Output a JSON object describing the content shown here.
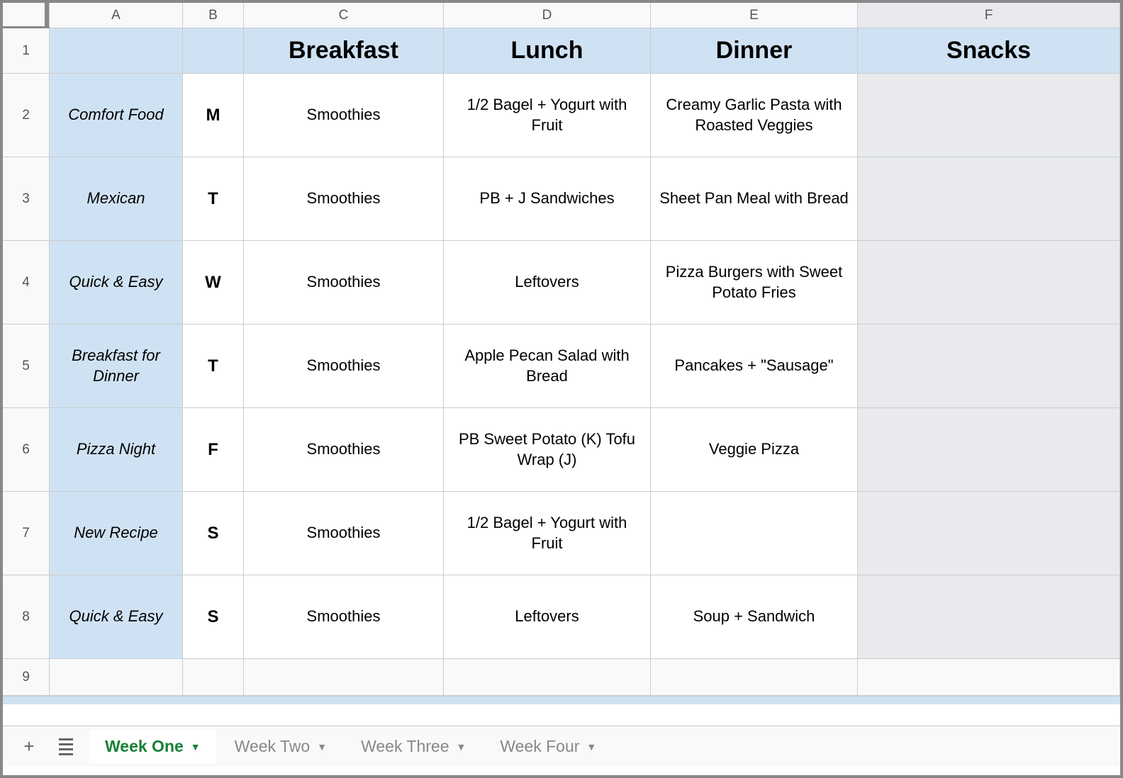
{
  "columns": [
    "A",
    "B",
    "C",
    "D",
    "E",
    "F"
  ],
  "rowNumbers": [
    "1",
    "2",
    "3",
    "4",
    "5",
    "6",
    "7",
    "8",
    "9"
  ],
  "headers": {
    "breakfast": "Breakfast",
    "lunch": "Lunch",
    "dinner": "Dinner",
    "snacks": "Snacks"
  },
  "rows": [
    {
      "category": "Comfort Food",
      "day": "M",
      "breakfast": "Smoothies",
      "lunch": "1/2 Bagel + Yogurt with Fruit",
      "dinner": "Creamy Garlic Pasta with Roasted Veggies"
    },
    {
      "category": "Mexican",
      "day": "T",
      "breakfast": "Smoothies",
      "lunch": "PB + J Sandwiches",
      "dinner": "Sheet Pan Meal with Bread"
    },
    {
      "category": "Quick & Easy",
      "day": "W",
      "breakfast": "Smoothies",
      "lunch": "Leftovers",
      "dinner": "Pizza Burgers with Sweet Potato Fries"
    },
    {
      "category": "Breakfast for Dinner",
      "day": "T",
      "breakfast": "Smoothies",
      "lunch": "Apple Pecan Salad with Bread",
      "dinner": "Pancakes + \"Sausage\""
    },
    {
      "category": "Pizza Night",
      "day": "F",
      "breakfast": "Smoothies",
      "lunch": "PB Sweet Potato (K) Tofu Wrap (J)",
      "dinner": "Veggie Pizza"
    },
    {
      "category": "New Recipe",
      "day": "S",
      "breakfast": "Smoothies",
      "lunch": "1/2 Bagel + Yogurt with Fruit",
      "dinner": ""
    },
    {
      "category": "Quick & Easy",
      "day": "S",
      "breakfast": "Smoothies",
      "lunch": "Leftovers",
      "dinner": "Soup + Sandwich"
    }
  ],
  "tabs": {
    "active": "Week One",
    "others": [
      "Week Two",
      "Week Three",
      "Week Four"
    ]
  }
}
